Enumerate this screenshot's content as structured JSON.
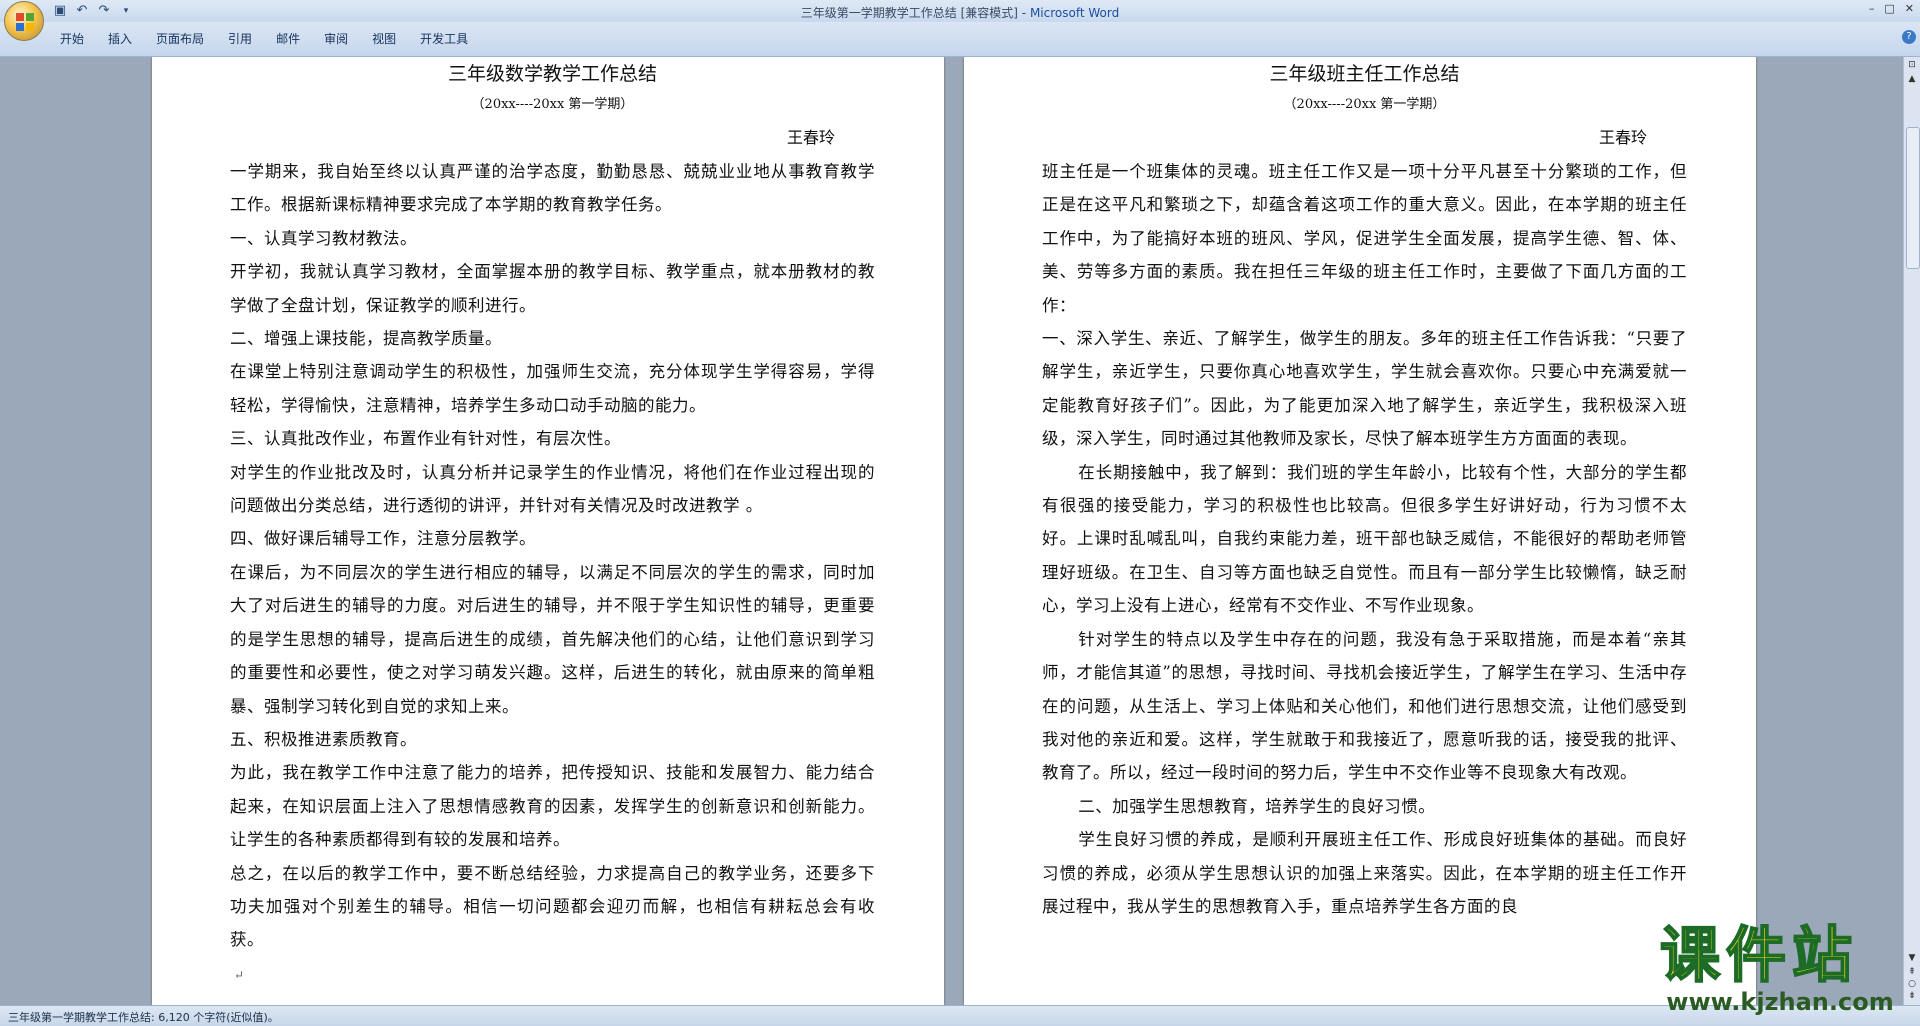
{
  "window": {
    "title_doc": "三年级第一学期教学工作总结 [兼容模式]",
    "title_sep": " - ",
    "title_app": "Microsoft Word",
    "controls": [
      "–",
      "□",
      "✕"
    ]
  },
  "qat": {
    "save_icon": "save-icon",
    "undo_icon": "undo-icon",
    "redo_icon": "redo-icon"
  },
  "ribbon": {
    "tabs": [
      "开始",
      "插入",
      "页面布局",
      "引用",
      "邮件",
      "审阅",
      "视图",
      "开发工具"
    ]
  },
  "page1": {
    "title": "三年级数学教学工作总结",
    "subtitle": "（20xx----20xx 第一学期）",
    "author": "王春玲",
    "paragraphs": [
      "一学期来，我自始至终以认真严谨的治学态度，勤勤恳恳、兢兢业业地从事教育教学工作。根据新课标精神要求完成了本学期的教育教学任务。",
      "一、认真学习教材教法。",
      "开学初，我就认真学习教材，全面掌握本册的教学目标、教学重点，就本册教材的教学做了全盘计划，保证教学的顺利进行。",
      "二、增强上课技能，提高教学质量。",
      "在课堂上特别注意调动学生的积极性，加强师生交流，充分体现学生学得容易，学得轻松，学得愉快，注意精神，培养学生多动口动手动脑的能力。",
      "三、认真批改作业，布置作业有针对性，有层次性。",
      "对学生的作业批改及时，认真分析并记录学生的作业情况，将他们在作业过程出现的问题做出分类总结，进行透彻的讲评，并针对有关情况及时改进教学 。",
      "四、做好课后辅导工作，注意分层教学。",
      "在课后，为不同层次的学生进行相应的辅导，以满足不同层次的学生的需求，同时加大了对后进生的辅导的力度。对后进生的辅导，并不限于学生知识性的辅导，更重要的是学生思想的辅导，提高后进生的成绩，首先解决他们的心结，让他们意识到学习的重要性和必要性，使之对学习萌发兴趣。这样，后进生的转化，就由原来的简单粗暴、强制学习转化到自觉的求知上来。",
      "五、积极推进素质教育。",
      "为此，我在教学工作中注意了能力的培养，把传授知识、技能和发展智力、能力结合起来，在知识层面上注入了思想情感教育的因素，发挥学生的创新意识和创新能力。让学生的各种素质都得到有较的发展和培养。",
      "总之，在以后的教学工作中，要不断总结经验，力求提高自己的教学业务，还要多下功夫加强对个别差生的辅导。相信一切问题都会迎刃而解，也相信有耕耘总会有收获。"
    ]
  },
  "page2": {
    "title": "三年级班主任工作总结",
    "subtitle": "（20xx----20xx 第一学期）",
    "author": "王春玲",
    "paragraphs": [
      "班主任是一个班集体的灵魂。班主任工作又是一项十分平凡甚至十分繁琐的工作，但正是在这平凡和繁琐之下，却蕴含着这项工作的重大意义。因此，在本学期的班主任工作中，为了能搞好本班的班风、学风，促进学生全面发展，提高学生德、智、体、美、劳等多方面的素质。我在担任三年级的班主任工作时，主要做了下面几方面的工作：",
      "一、深入学生、亲近、了解学生，做学生的朋友。多年的班主任工作告诉我：“只要了解学生，亲近学生，只要你真心地喜欢学生，学生就会喜欢你。只要心中充满爱就一定能教育好孩子们”。因此，为了能更加深入地了解学生，亲近学生，我积极深入班级，深入学生，同时通过其他教师及家长，尽快了解本班学生方方面面的表现。",
      "在长期接触中，我了解到：我们班的学生年龄小，比较有个性，大部分的学生都有很强的接受能力，学习的积极性也比较高。但很多学生好讲好动，行为习惯不太好。上课时乱喊乱叫，自我约束能力差，班干部也缺乏威信，不能很好的帮助老师管理好班级。在卫生、自习等方面也缺乏自觉性。而且有一部分学生比较懒惰，缺乏耐心，学习上没有上进心，经常有不交作业、不写作业现象。",
      "针对学生的特点以及学生中存在的问题，我没有急于采取措施，而是本着“亲其师，才能信其道”的思想，寻找时间、寻找机会接近学生，了解学生在学习、生活中存在的问题，从生活上、学习上体贴和关心他们，和他们进行思想交流，让他们感受到我对他的亲近和爱。这样，学生就敢于和我接近了，愿意听我的话，接受我的批评、教育了。所以，经过一段时间的努力后，学生中不交作业等不良现象大有改观。",
      "二、加强学生思想教育，培养学生的良好习惯。",
      "学生良好习惯的养成，是顺利开展班主任工作、形成良好班集体的基础。而良好习惯的养成，必须从学生思想认识的加强上来落实。因此，在本学期的班主任工作开展过程中，我从学生的思想教育入手，重点培养学生各方面的良"
    ]
  },
  "status": {
    "text": "三年级第一学期教学工作总结: 6,120 个字符(近似值)。"
  },
  "watermark": {
    "main": "课件站",
    "url": "www.kjzhan.com"
  }
}
